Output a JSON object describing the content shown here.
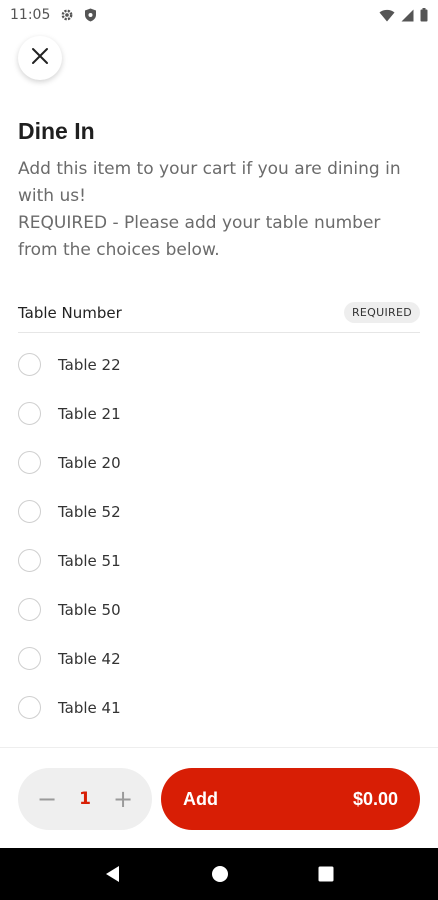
{
  "status_bar": {
    "time": "11:05",
    "icons": [
      "gear-icon",
      "shield-icon",
      "wifi-icon",
      "signal-icon",
      "battery-icon"
    ]
  },
  "header": {
    "close_icon": "close-icon"
  },
  "item": {
    "title": "Dine In",
    "description_line1": "Add this item to your cart if you are dining in with us!",
    "description_line2": "REQUIRED - Please add your table number from the choices below."
  },
  "section": {
    "label": "Table Number",
    "badge": "REQUIRED"
  },
  "options": [
    {
      "label": "Table 22",
      "selected": false
    },
    {
      "label": "Table 21",
      "selected": false
    },
    {
      "label": "Table 20",
      "selected": false
    },
    {
      "label": "Table 52",
      "selected": false
    },
    {
      "label": "Table 51",
      "selected": false
    },
    {
      "label": "Table 50",
      "selected": false
    },
    {
      "label": "Table 42",
      "selected": false
    },
    {
      "label": "Table 41",
      "selected": false
    }
  ],
  "footer": {
    "minus": "−",
    "quantity": "1",
    "plus": "+",
    "add_label": "Add",
    "price": "$0.00"
  },
  "colors": {
    "accent": "#d81e05",
    "stepper_bg": "#efefef"
  }
}
